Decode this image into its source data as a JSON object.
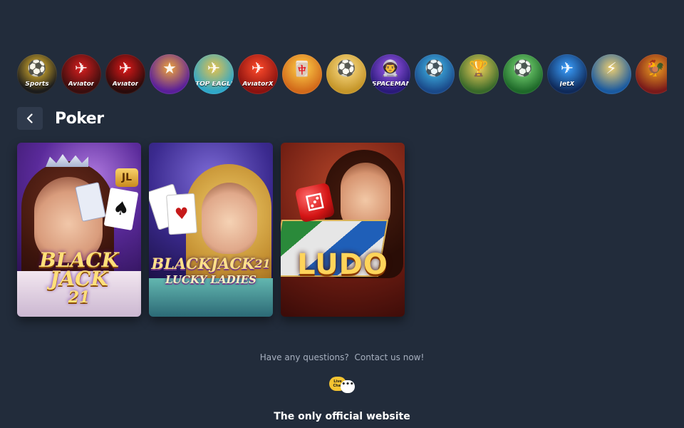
{
  "games_strip": [
    {
      "label": "Sports",
      "icon": "soccer-ball-icon",
      "glyph": "⚽",
      "color": "#1c1c1c",
      "accent": "#f4c431"
    },
    {
      "label": "Aviator",
      "icon": "red-plane-icon",
      "glyph": "✈",
      "color": "#3a0e0e",
      "accent": "#d81e1e"
    },
    {
      "label": "Aviator",
      "icon": "red-plane-icon",
      "glyph": "✈",
      "color": "#2a0b0b",
      "accent": "#e01818"
    },
    {
      "label": "",
      "icon": "game-logo-icon",
      "glyph": "★",
      "color": "#5a1f9a",
      "accent": "#f0a53a"
    },
    {
      "label": "TOP EAGLE",
      "icon": "propeller-plane-icon",
      "glyph": "✈",
      "color": "#2fa7c8",
      "accent": "#e7c24a"
    },
    {
      "label": "AviatorX",
      "icon": "jet-plane-icon",
      "glyph": "✈",
      "color": "#8a120f",
      "accent": "#ff4a2a"
    },
    {
      "label": "",
      "icon": "mahjong-tiles-icon",
      "glyph": "🀄",
      "color": "#d26a1a",
      "accent": "#ffd24a"
    },
    {
      "label": "",
      "icon": "champions-league-icon",
      "glyph": "⚽",
      "color": "#c5962a",
      "accent": "#ffe08a"
    },
    {
      "label": "SPACEMAN",
      "icon": "astronaut-icon",
      "glyph": "👨‍🚀",
      "color": "#2a1a7a",
      "accent": "#a05af0"
    },
    {
      "label": "",
      "icon": "turbo-league-icon",
      "glyph": "⚽",
      "color": "#1a4a8a",
      "accent": "#44c0f0"
    },
    {
      "label": "",
      "icon": "world-cup-icon",
      "glyph": "🏆",
      "color": "#3a6a2a",
      "accent": "#f0d05a"
    },
    {
      "label": "",
      "icon": "league-soccer-icon",
      "glyph": "⚽",
      "color": "#1f6a2a",
      "accent": "#7fe07a"
    },
    {
      "label": "JetX",
      "icon": "jetx-icon",
      "glyph": "✈",
      "color": "#0f2a5a",
      "accent": "#3aa0ff"
    },
    {
      "label": "",
      "icon": "zeus-icon",
      "glyph": "⚡",
      "color": "#1a5aa0",
      "accent": "#f0d070"
    },
    {
      "label": "",
      "icon": "rooster-icon",
      "glyph": "🐓",
      "color": "#7a1a1a",
      "accent": "#f0a020"
    }
  ],
  "section": {
    "title": "Poker"
  },
  "games": [
    {
      "title_line1": "BLACK",
      "title_line2": "JACK",
      "number": "21",
      "badge": "JL"
    },
    {
      "title_line1": "BLACKJACK",
      "number": "21",
      "subtitle": "LUCKY LADIES"
    },
    {
      "title": "LUDO"
    }
  ],
  "footer": {
    "question": "Have any questions?",
    "contact_link": "Contact us now!",
    "live_chat_line1": "Live",
    "live_chat_line2": "Chat",
    "official": "The only official website"
  }
}
